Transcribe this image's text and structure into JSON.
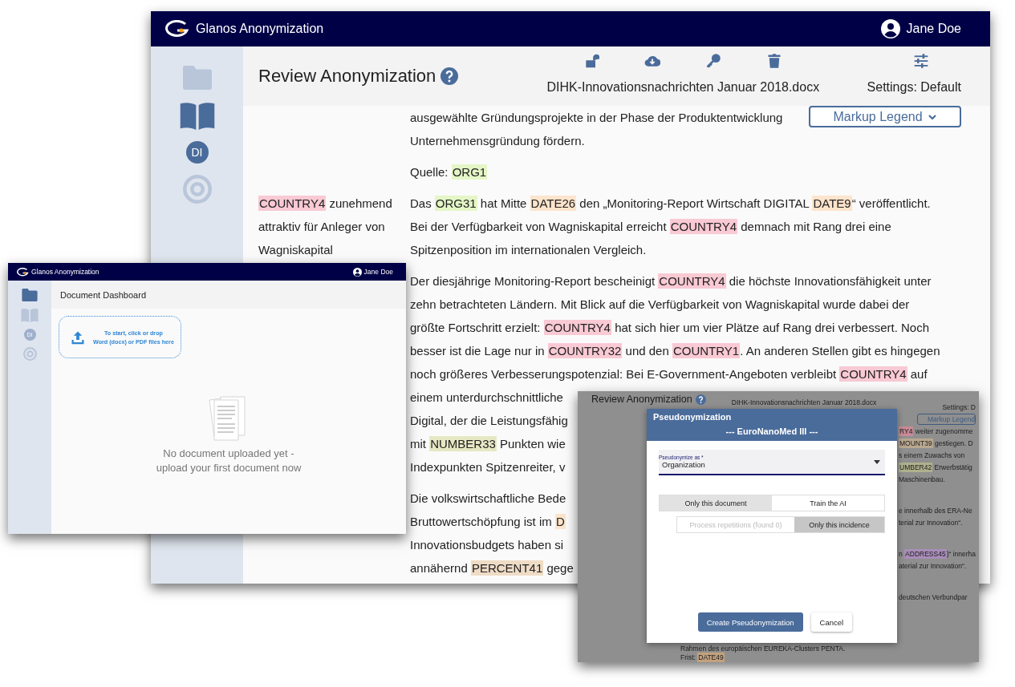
{
  "review_window": {
    "app_title": "Glanos Anonymization",
    "user": "Jane Doe",
    "sidebar": [
      {
        "selected": false
      },
      {
        "selected": true
      },
      {
        "label": "DI",
        "selected": true
      },
      {
        "selected": false
      }
    ],
    "page_title": "Review Anonymization",
    "file_name": "DIHK-Innovationsnachrichten Januar 2018.docx",
    "settings_label": "Settings: Default",
    "legend_button": "Markup Legend",
    "paragraphs": [
      {
        "lines": [
          [
            {
              "text": "ausgewählte Gründungsprojekte in der Phase der Produktentwicklung"
            }
          ],
          [
            {
              "text": "Unternehmensgründung fördern."
            }
          ]
        ]
      },
      {
        "lines": [
          [
            {
              "text": "Quelle: "
            },
            {
              "text": "ORG1",
              "color": "#e4f6c6"
            }
          ]
        ]
      },
      {
        "side_note": [
          {
            "text": "COUNTRY4",
            "color": "#f9c9d4"
          },
          {
            "text": " zunehmend attraktiv für Anleger von Wagniskapital"
          }
        ],
        "lines": [
          [
            {
              "text": "Das "
            },
            {
              "text": "ORG31",
              "color": "#e4f6c6"
            },
            {
              "text": " hat Mitte "
            },
            {
              "text": "DATE26",
              "color": "#fde4cc"
            },
            {
              "text": " den „Monitoring-Report Wirtschaft DIGITAL "
            },
            {
              "text": "DATE9",
              "color": "#fde4cc"
            },
            {
              "text": "“ veröffentlicht."
            }
          ],
          [
            {
              "text": "Bei der Verfügbarkeit von Wagniskapital erreicht "
            },
            {
              "text": "COUNTRY4",
              "color": "#f9c9d4"
            },
            {
              "text": " demnach mit Rang drei eine"
            }
          ],
          [
            {
              "text": "Spitzenposition im internationalen Vergleich."
            }
          ]
        ]
      },
      {
        "lines": [
          [
            {
              "text": "Der diesjährige Monitoring-Report bescheinigt "
            },
            {
              "text": "COUNTRY4",
              "color": "#f9c9d4"
            },
            {
              "text": " die höchste Innovationsfähigkeit unter"
            }
          ],
          [
            {
              "text": "zehn betrachteten Ländern. Mit Blick auf die Verfügbarkeit von Wagniskapital wurde dabei der"
            }
          ],
          [
            {
              "text": "größte Fortschritt erzielt: "
            },
            {
              "text": "COUNTRY4",
              "color": "#f9c9d4"
            },
            {
              "text": " hat sich hier um vier Plätze auf Rang drei verbessert. Noch"
            }
          ],
          [
            {
              "text": "besser ist die Lage nur in "
            },
            {
              "text": "COUNTRY32",
              "color": "#f9c9d4"
            },
            {
              "text": " und den "
            },
            {
              "text": "COUNTRY1",
              "color": "#f9c9d4"
            },
            {
              "text": ". An anderen Stellen gibt es hingegen"
            }
          ],
          [
            {
              "text": "noch größeres Verbesserungspotenzial: Bei E-Government-Angeboten verbleibt "
            },
            {
              "text": "COUNTRY4",
              "color": "#f9c9d4"
            },
            {
              "text": " auf"
            }
          ],
          [
            {
              "text": "einem unterdurchschnittliche"
            }
          ],
          [
            {
              "text": "Digital, der die Leistungsfähig"
            }
          ],
          [
            {
              "text": "mit "
            },
            {
              "text": "NUMBER33",
              "color": "#e6e8c4"
            },
            {
              "text": " Punkten wie"
            }
          ],
          [
            {
              "text": "Indexpunkten Spitzenreiter, v"
            }
          ]
        ]
      },
      {
        "lines": [
          [
            {
              "text": "Die volkswirtschaftliche Bede"
            }
          ],
          [
            {
              "text": "Bruttowertschöpfung ist im "
            },
            {
              "text": "D",
              "color": "#fde4cc"
            }
          ],
          [
            {
              "text": "Innovationsbudgets haben si"
            }
          ],
          [
            {
              "text": "annähernd "
            },
            {
              "text": "PERCENT41",
              "color": "#efdcc6"
            },
            {
              "text": " gege"
            }
          ]
        ]
      }
    ]
  },
  "dashboard_window": {
    "app_title": "Glanos Anonymization",
    "user": "Jane Doe",
    "sidebar": [
      {
        "selected": true
      },
      {
        "selected": false
      },
      {
        "label": "DI",
        "selected": false
      },
      {
        "selected": false
      }
    ],
    "page_title": "Document Dashboard",
    "upload_prompt": "To start, click or drop\nWord (docx) or PDF files here",
    "empty_message": "No document uploaded yet -\nupload your first document now"
  },
  "dialog_window": {
    "background": {
      "page_title": "Review Anonymization",
      "file_name": "DIHK-Innovationsnachrichten Januar 2018.docx",
      "settings_label": "Settings: D",
      "legend_button": "Markup Legend",
      "side_paragraphs": [
        {
          "lines": [
            [
              {
                "text": "RY4",
                "color": "#c78b97"
              },
              {
                "text": " weiter zugenomme"
              }
            ],
            [
              {
                "text": "MOUNT39",
                "color": "#b9a88f"
              },
              {
                "text": " gestiegen. D"
              }
            ],
            [
              {
                "text": "s einem Zuwachs von"
              }
            ],
            [
              {
                "text": "UMBER42",
                "color": "#aeb18c"
              },
              {
                "text": " Erwerbstätig"
              }
            ],
            [
              {
                "text": "Maschinenbau."
              }
            ]
          ]
        },
        {
          "lines": [
            [
              {
                "text": "e innerhalb des ERA-Ne"
              }
            ],
            [
              {
                "text": "terial zur Innovation“."
              }
            ]
          ]
        },
        {
          "lines": [
            [
              {
                "text": "n "
              },
              {
                "text": "ADDRESS45",
                "color": "#a98db9"
              },
              {
                "text": ")“ innerha"
              }
            ],
            [
              {
                "text": "aterial zur Innovation“."
              }
            ]
          ]
        },
        {
          "lines": [
            [
              {
                "text": "deutschen Verbundpar"
              }
            ]
          ]
        }
      ],
      "bottom_lines": [
        [
          {
            "text": "Rahmen des europäischen EUREKA-Clusters PENTA."
          }
        ],
        [
          {
            "text": "Frist: "
          },
          {
            "text": "DATE49",
            "color": "#c2a27e"
          }
        ]
      ]
    },
    "dialog": {
      "title": "Pseudonymization",
      "subtitle": "--- EuroNanoMed III ---",
      "select": {
        "label": "Pseudonymize as *",
        "value": "Organization"
      },
      "scope_options": [
        {
          "label": "Only this document",
          "selected": true
        },
        {
          "label": "Train the AI",
          "selected": false
        }
      ],
      "repetition_options": [
        {
          "label": "Process repetitions (found 0)",
          "selected": false,
          "disabled": true
        },
        {
          "label": "Only this incidence",
          "selected": true,
          "disabled": false
        }
      ],
      "buttons": [
        {
          "label": "Create Pseudonymization",
          "kind": "primary"
        },
        {
          "label": "Cancel",
          "kind": "secondary"
        }
      ]
    }
  }
}
